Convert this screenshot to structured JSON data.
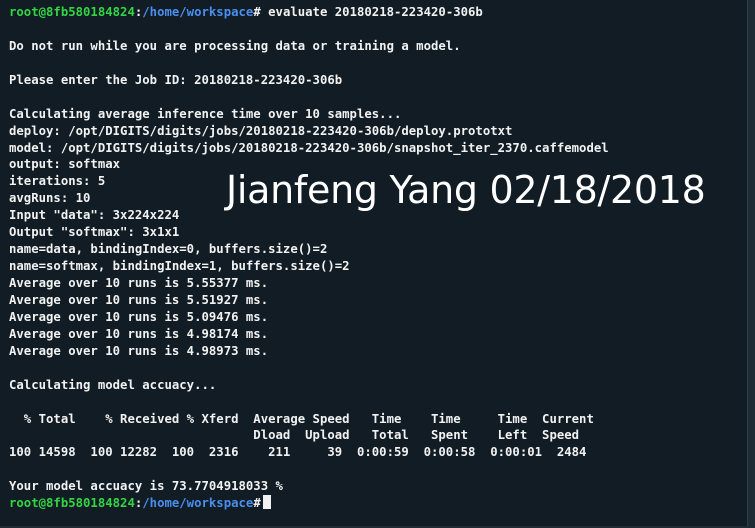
{
  "prompt": {
    "user_host": "root@8fb580184824",
    "path": "/home/workspace",
    "symbol": "#"
  },
  "command": " evaluate 20180218-223420-306b",
  "lines": [
    "",
    "Do not run while you are processing data or training a model.",
    "",
    "Please enter the Job ID: 20180218-223420-306b",
    "",
    "Calculating average inference time over 10 samples...",
    "deploy: /opt/DIGITS/digits/jobs/20180218-223420-306b/deploy.prototxt",
    "model: /opt/DIGITS/digits/jobs/20180218-223420-306b/snapshot_iter_2370.caffemodel",
    "output: softmax",
    "iterations: 5",
    "avgRuns: 10",
    "Input \"data\": 3x224x224",
    "Output \"softmax\": 3x1x1",
    "name=data, bindingIndex=0, buffers.size()=2",
    "name=softmax, bindingIndex=1, buffers.size()=2",
    "Average over 10 runs is 5.55377 ms.",
    "Average over 10 runs is 5.51927 ms.",
    "Average over 10 runs is 5.09476 ms.",
    "Average over 10 runs is 4.98174 ms.",
    "Average over 10 runs is 4.98973 ms.",
    "",
    "Calculating model accuacy...",
    "",
    "  % Total    % Received % Xferd  Average Speed   Time    Time     Time  Current",
    "                                 Dload  Upload   Total   Spent    Left  Speed",
    "100 14598  100 12282  100  2316    211     39  0:00:59  0:00:58  0:00:01  2484",
    "",
    "Your model accuacy is 73.7704918033 %"
  ],
  "watermark": "Jianfeng Yang 02/18/2018",
  "colors": {
    "background": "#111c24",
    "text": "#f2f2f2",
    "user_host": "#33d642",
    "path": "#4a8ff0"
  }
}
